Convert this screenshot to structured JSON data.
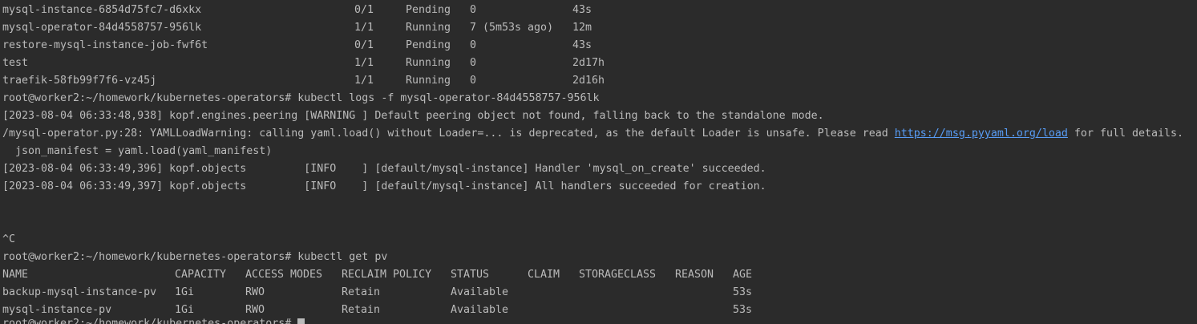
{
  "terminal": {
    "pods": [
      {
        "name": "mysql-instance-6854d75fc7-d6xkx",
        "ready": "0/1",
        "status": "Pending",
        "restarts": "0",
        "age": "43s"
      },
      {
        "name": "mysql-operator-84d4558757-956lk",
        "ready": "1/1",
        "status": "Running",
        "restarts": "7 (5m53s ago)",
        "age": "12m"
      },
      {
        "name": "restore-mysql-instance-job-fwf6t",
        "ready": "0/1",
        "status": "Pending",
        "restarts": "0",
        "age": "43s"
      },
      {
        "name": "test",
        "ready": "1/1",
        "status": "Running",
        "restarts": "0",
        "age": "2d17h"
      },
      {
        "name": "traefik-58fb99f7f6-vz45j",
        "ready": "1/1",
        "status": "Running",
        "restarts": "0",
        "age": "2d16h"
      }
    ],
    "cmd_logs": "root@worker2:~/homework/kubernetes-operators# kubectl logs -f mysql-operator-84d4558757-956lk",
    "log_peering": "[2023-08-04 06:33:48,938] kopf.engines.peering [WARNING ] Default peering object not found, falling back to the standalone mode.",
    "log_yaml_prefix": "/mysql-operator.py:28: YAMLLoadWarning: calling yaml.load() without Loader=... is deprecated, as the default Loader is unsafe. Please read ",
    "log_yaml_link": "https://msg.pyyaml.org/load",
    "log_yaml_suffix": " for full details.",
    "log_manifest": "  json_manifest = yaml.load(yaml_manifest)",
    "log_handler": "[2023-08-04 06:33:49,396] kopf.objects         [INFO    ] [default/mysql-instance] Handler 'mysql_on_create' succeeded.",
    "log_all_handlers": "[2023-08-04 06:33:49,397] kopf.objects         [INFO    ] [default/mysql-instance] All handlers succeeded for creation.",
    "interrupt": "^C",
    "cmd_pv": "root@worker2:~/homework/kubernetes-operators# kubectl get pv",
    "pv_headers": {
      "name": "NAME",
      "capacity": "CAPACITY",
      "access_modes": "ACCESS MODES",
      "reclaim_policy": "RECLAIM POLICY",
      "status": "STATUS",
      "claim": "CLAIM",
      "storageclass": "STORAGECLASS",
      "reason": "REASON",
      "age": "AGE"
    },
    "pvs": [
      {
        "name": "backup-mysql-instance-pv",
        "capacity": "1Gi",
        "access_modes": "RWO",
        "reclaim_policy": "Retain",
        "status": "Available",
        "age": "53s"
      },
      {
        "name": "mysql-instance-pv",
        "capacity": "1Gi",
        "access_modes": "RWO",
        "reclaim_policy": "Retain",
        "status": "Available",
        "age": "53s"
      }
    ],
    "prompt": "root@worker2:~/homework/kubernetes-operators# "
  },
  "colors": {
    "background": "#2b2b2b",
    "foreground": "#bbbbbb",
    "link": "#589df6"
  }
}
